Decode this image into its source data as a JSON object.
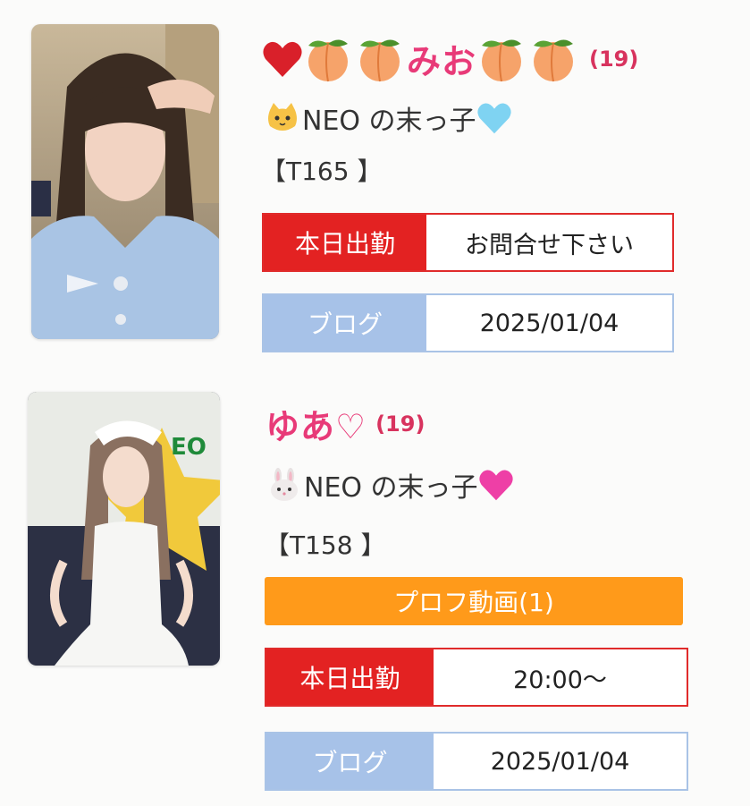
{
  "cast": [
    {
      "name": "みお",
      "age": "(19)",
      "catch": "NEO の末っ子",
      "height": "【T165 】",
      "attendance_label": "本日出勤",
      "attendance_value": "お問合せ下さい",
      "blog_label": "ブログ",
      "blog_date": "2025/01/04"
    },
    {
      "name": "ゆあ♡",
      "age": "(19)",
      "catch": "NEO の末っ子",
      "height": "【T158 】",
      "video_label": "プロフ動画(1)",
      "attendance_label": "本日出勤",
      "attendance_value": "20:00〜",
      "blog_label": "ブログ",
      "blog_date": "2025/01/04"
    }
  ],
  "colors": {
    "name_pink": "#e83a78",
    "attendance_red": "#e32222",
    "blog_blue": "#a7c2e8",
    "video_orange": "#ff9a1a"
  }
}
